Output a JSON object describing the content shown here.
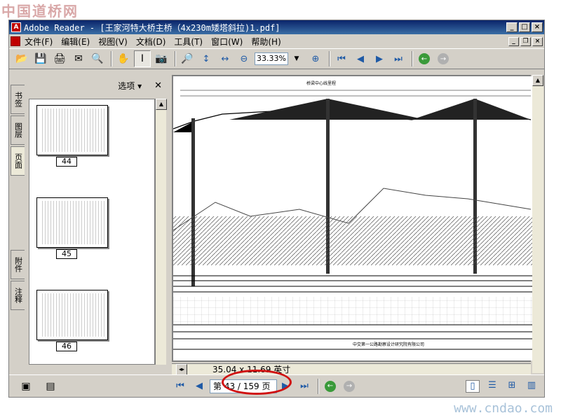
{
  "watermarks": {
    "top": "中国道桥网",
    "bottom": "www.cndao.com"
  },
  "window": {
    "title": "Adobe Reader - [王家河特大桥主桥（4x230m矮塔斜拉)1.pdf]",
    "app_icon_label": "A"
  },
  "menu": {
    "items": [
      "文件(F)",
      "编辑(E)",
      "视图(V)",
      "文档(D)",
      "工具(T)",
      "窗口(W)",
      "帮助(H)"
    ]
  },
  "toolbar": {
    "zoom_value": "33.33%",
    "icons": [
      "open-icon",
      "save-icon",
      "print-icon",
      "email-icon",
      "search-icon",
      "hand-icon",
      "select-text-icon",
      "snapshot-icon",
      "zoom-in-tool-icon",
      "fit-page-icon",
      "fit-width-icon",
      "zoom-out-icon",
      "zoom-in-icon",
      "first-page-icon",
      "prev-page-icon",
      "next-page-icon",
      "last-page-icon",
      "back-icon",
      "forward-icon"
    ]
  },
  "side_tabs": {
    "bookmarks": "书签",
    "layers": "图层",
    "pages": "页面",
    "attachments": "附件",
    "comments": "注释"
  },
  "panel": {
    "options_label": "选项",
    "thumbnails": [
      {
        "label": "44"
      },
      {
        "label": "45"
      },
      {
        "label": "46"
      }
    ]
  },
  "document": {
    "page_size": "35.04 x 11.69 英寸",
    "drawing_title": "桥梁中心线里程",
    "footer_company": "中交第一公路勘察设计研究院有限公司"
  },
  "statusbar": {
    "page_indicator": "第 43 / 159 页",
    "current_page": 43,
    "total_pages": 159
  }
}
